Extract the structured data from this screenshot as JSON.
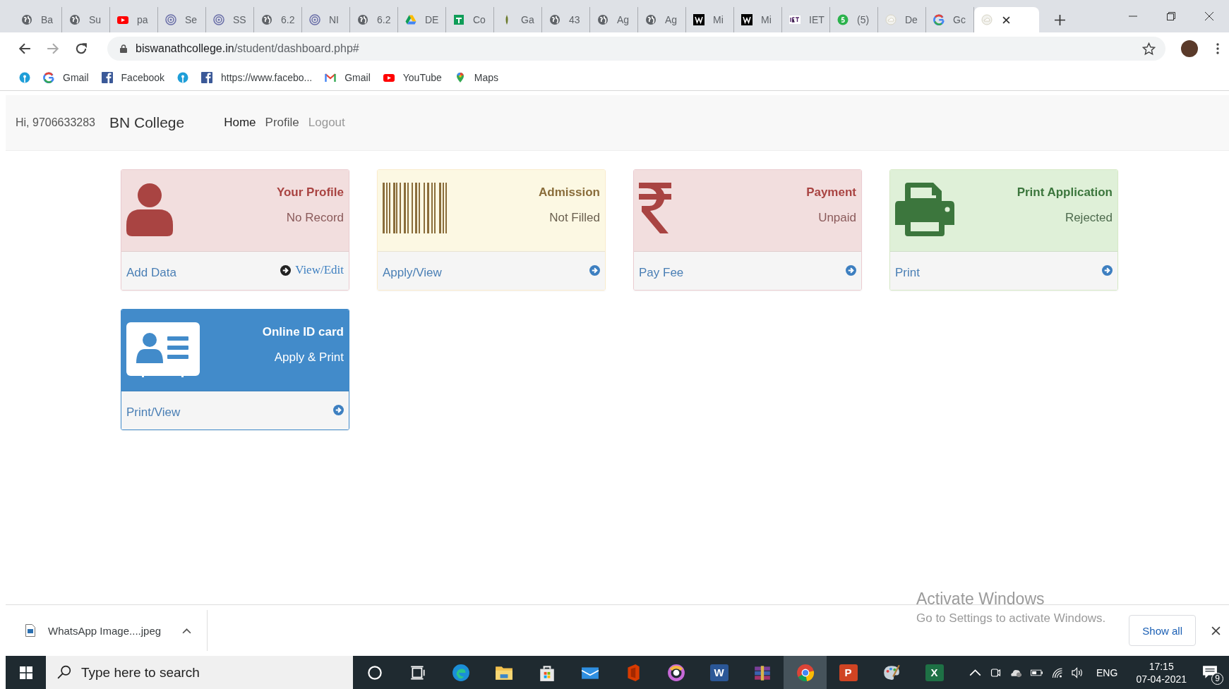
{
  "browser": {
    "tabs": [
      {
        "kind": "globe",
        "label": "Ba",
        "selected": false
      },
      {
        "kind": "globe",
        "label": "Su",
        "selected": false
      },
      {
        "kind": "youtube",
        "label": "pa",
        "selected": false
      },
      {
        "kind": "ring",
        "label": "Se",
        "selected": false
      },
      {
        "kind": "ring",
        "label": "SS",
        "selected": false
      },
      {
        "kind": "globe",
        "label": "6.2",
        "selected": false
      },
      {
        "kind": "ring",
        "label": "NI",
        "selected": false
      },
      {
        "kind": "globe",
        "label": "6.2",
        "selected": false
      },
      {
        "kind": "drive",
        "label": "DE",
        "selected": false
      },
      {
        "kind": "sheets",
        "label": "Co",
        "selected": false
      },
      {
        "kind": "leaf",
        "label": "Ga",
        "selected": false
      },
      {
        "kind": "globe",
        "label": "43",
        "selected": false
      },
      {
        "kind": "globe",
        "label": "Ag",
        "selected": false
      },
      {
        "kind": "globe",
        "label": "Ag",
        "selected": false
      },
      {
        "kind": "w",
        "label": "Mi",
        "selected": false
      },
      {
        "kind": "w",
        "label": "Mi",
        "selected": false
      },
      {
        "kind": "iet",
        "label": "IET",
        "selected": false
      },
      {
        "kind": "green",
        "label": "(5)",
        "selected": false
      },
      {
        "kind": "cloud",
        "label": "De",
        "selected": false
      },
      {
        "kind": "google",
        "label": "Gc",
        "selected": false
      },
      {
        "kind": "cloud",
        "selected": true
      }
    ],
    "url_domain": "biswanathcollege.in",
    "url_path": "/student/dashboard.php#",
    "bookmarks": [
      {
        "kind": "sbi"
      },
      {
        "kind": "google",
        "label": "Gmail"
      },
      {
        "kind": "facebook",
        "label": "Facebook"
      },
      {
        "kind": "sbi"
      },
      {
        "kind": "facebook",
        "label": "https://www.facebo..."
      },
      {
        "kind": "gmail",
        "label": "Gmail"
      },
      {
        "kind": "youtube",
        "label": "YouTube"
      },
      {
        "kind": "maps",
        "label": "Maps"
      }
    ]
  },
  "navbar": {
    "greeting": "Hi, 9706633283",
    "brand": "BN College",
    "links": [
      {
        "label": "Home",
        "selected": true,
        "muted": false
      },
      {
        "label": "Profile",
        "selected": false,
        "muted": false
      },
      {
        "label": "Logout",
        "selected": false,
        "muted": true
      }
    ]
  },
  "cards": [
    {
      "kind": "person",
      "title": "Your Profile",
      "status": "No Record",
      "link": "Add Data",
      "action": "View/Edit"
    },
    {
      "kind": "barcode",
      "title": "Admission",
      "status": "Not Filled",
      "link": "Apply/View"
    },
    {
      "kind": "rupee",
      "title": "Payment",
      "status": "Unpaid",
      "link": "Pay Fee"
    },
    {
      "kind": "printer",
      "title": "Print Application",
      "status": "Rejected",
      "link": "Print"
    },
    {
      "kind": "idcard",
      "title": "Online ID card",
      "status": "Apply & Print",
      "link": "Print/View"
    }
  ],
  "download_bar": {
    "file": "WhatsApp Image....jpeg",
    "show_all": "Show all"
  },
  "os_overlay": {
    "title": "Activate Windows",
    "subtitle": "Go to Settings to activate Windows."
  },
  "taskbar": {
    "search_placeholder": "Type here to search",
    "apps": [
      {
        "kind": "cortana",
        "selected": false
      },
      {
        "kind": "taskview",
        "selected": false
      },
      {
        "kind": "edge",
        "selected": false
      },
      {
        "kind": "explorer",
        "selected": false
      },
      {
        "kind": "store",
        "selected": false
      },
      {
        "kind": "mail",
        "selected": false
      },
      {
        "kind": "office",
        "selected": false
      },
      {
        "kind": "photos",
        "selected": false
      },
      {
        "kind": "word",
        "label": "W",
        "selected": false
      },
      {
        "kind": "winrar",
        "selected": false
      },
      {
        "kind": "chrome",
        "selected": true
      },
      {
        "kind": "powerpoint",
        "label": "P",
        "selected": false
      },
      {
        "kind": "paint",
        "selected": false
      },
      {
        "kind": "excel",
        "label": "X",
        "selected": false
      }
    ],
    "language": "ENG",
    "time": "17:15",
    "date": "07-04-2021",
    "notifications": "9"
  }
}
